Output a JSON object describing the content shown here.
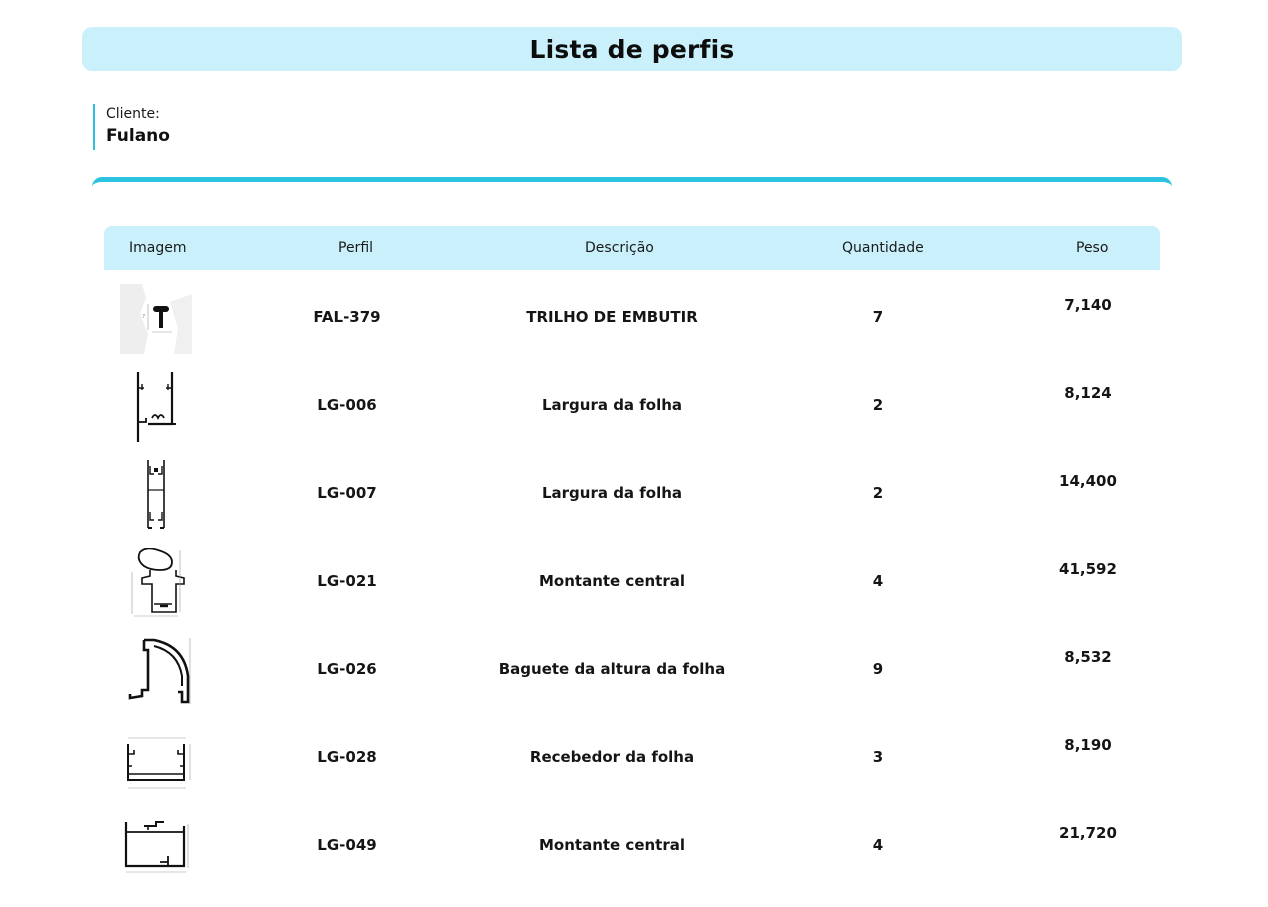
{
  "header": {
    "title": "Lista de perfis"
  },
  "client": {
    "label": "Cliente:",
    "name": "Fulano"
  },
  "table": {
    "columns": [
      "Imagem",
      "Perfil",
      "Descrição",
      "Quantidade",
      "Peso"
    ],
    "rows": [
      {
        "image_icon": "t-rail-profile-drawing",
        "perfil": "FAL-379",
        "descricao": "TRILHO DE EMBUTIR",
        "quantidade": "7",
        "peso": "7,140"
      },
      {
        "image_icon": "frame-profile-drawing",
        "perfil": "LG-006",
        "descricao": "Largura da folha",
        "quantidade": "2",
        "peso": "8,124"
      },
      {
        "image_icon": "narrow-frame-profile-drawing",
        "perfil": "LG-007",
        "descricao": "Largura da folha",
        "quantidade": "2",
        "peso": "14,400"
      },
      {
        "image_icon": "mullion-handle-profile-drawing",
        "perfil": "LG-021",
        "descricao": "Montante central",
        "quantidade": "4",
        "peso": "41,592"
      },
      {
        "image_icon": "curved-bead-profile-drawing",
        "perfil": "LG-026",
        "descricao": "Baguete da altura da folha",
        "quantidade": "9",
        "peso": "8,532"
      },
      {
        "image_icon": "u-channel-profile-drawing",
        "perfil": "LG-028",
        "descricao": "Recebedor da folha",
        "quantidade": "3",
        "peso": "8,190"
      },
      {
        "image_icon": "box-mullion-profile-drawing",
        "perfil": "LG-049",
        "descricao": "Montante central",
        "quantidade": "4",
        "peso": "21,720"
      }
    ]
  },
  "colors": {
    "accent": "#2cc3e0",
    "header_bg": "#c9f0fb"
  }
}
